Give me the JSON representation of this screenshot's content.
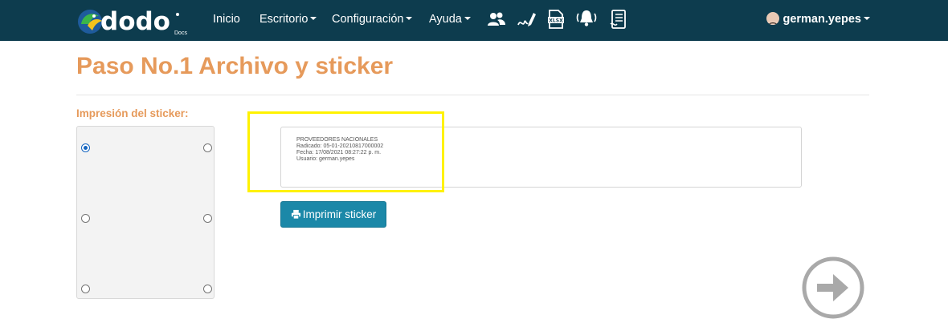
{
  "navbar": {
    "logo_text": "dodo",
    "logo_sub": "Docs",
    "items": [
      {
        "label": "Inicio",
        "has_caret": false
      },
      {
        "label": "Escritorio",
        "has_caret": true
      },
      {
        "label": "Configuración",
        "has_caret": true
      },
      {
        "label": "Ayuda",
        "has_caret": true
      }
    ],
    "icons": [
      "users-icon",
      "signature-icon",
      "xlsx-file-icon",
      "bell-alert-icon",
      "document-list-icon"
    ],
    "user": "german.yepes"
  },
  "page": {
    "title": "Paso No.1 Archivo y sticker",
    "position_label": "Impresión del sticker:"
  },
  "sticker": {
    "lines": [
      "PROVEEDORES NACIONALES",
      "Radicado: 05-01-20210817000002",
      "Fecha: 17/08/2021 08:27:22 p. m.",
      "Usuario: german.yepes"
    ]
  },
  "actions": {
    "print_label": "Imprimir sticker"
  },
  "colors": {
    "navbar": "#0d3c4e",
    "accent": "#e69a5b",
    "button": "#1b88a8",
    "highlight": "#fff200"
  }
}
